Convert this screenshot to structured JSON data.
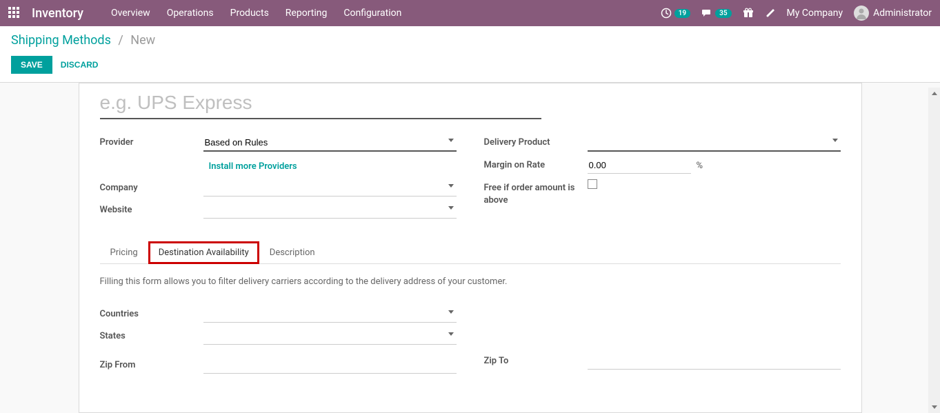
{
  "topbar": {
    "app_title": "Inventory",
    "nav": [
      "Overview",
      "Operations",
      "Products",
      "Reporting",
      "Configuration"
    ],
    "activity_count": "19",
    "messages_count": "35",
    "company": "My Company",
    "user": "Administrator"
  },
  "breadcrumb": {
    "parent": "Shipping Methods",
    "current": "New"
  },
  "buttons": {
    "save": "Save",
    "discard": "Discard"
  },
  "form": {
    "title_placeholder": "e.g. UPS Express",
    "left": {
      "provider_label": "Provider",
      "provider_value": "Based on Rules",
      "install_link": "Install more Providers",
      "company_label": "Company",
      "company_value": "",
      "website_label": "Website",
      "website_value": ""
    },
    "right": {
      "delivery_product_label": "Delivery Product",
      "delivery_product_value": "",
      "margin_label": "Margin on Rate",
      "margin_value": "0.00",
      "margin_unit": "%",
      "free_label": "Free if order amount is above"
    }
  },
  "tabs": {
    "items": [
      "Pricing",
      "Destination Availability",
      "Description"
    ],
    "description_text": "Filling this form allows you to filter delivery carriers according to the delivery address of your customer.",
    "fields": {
      "countries_label": "Countries",
      "states_label": "States",
      "zip_from_label": "Zip From",
      "zip_to_label": "Zip To"
    }
  }
}
